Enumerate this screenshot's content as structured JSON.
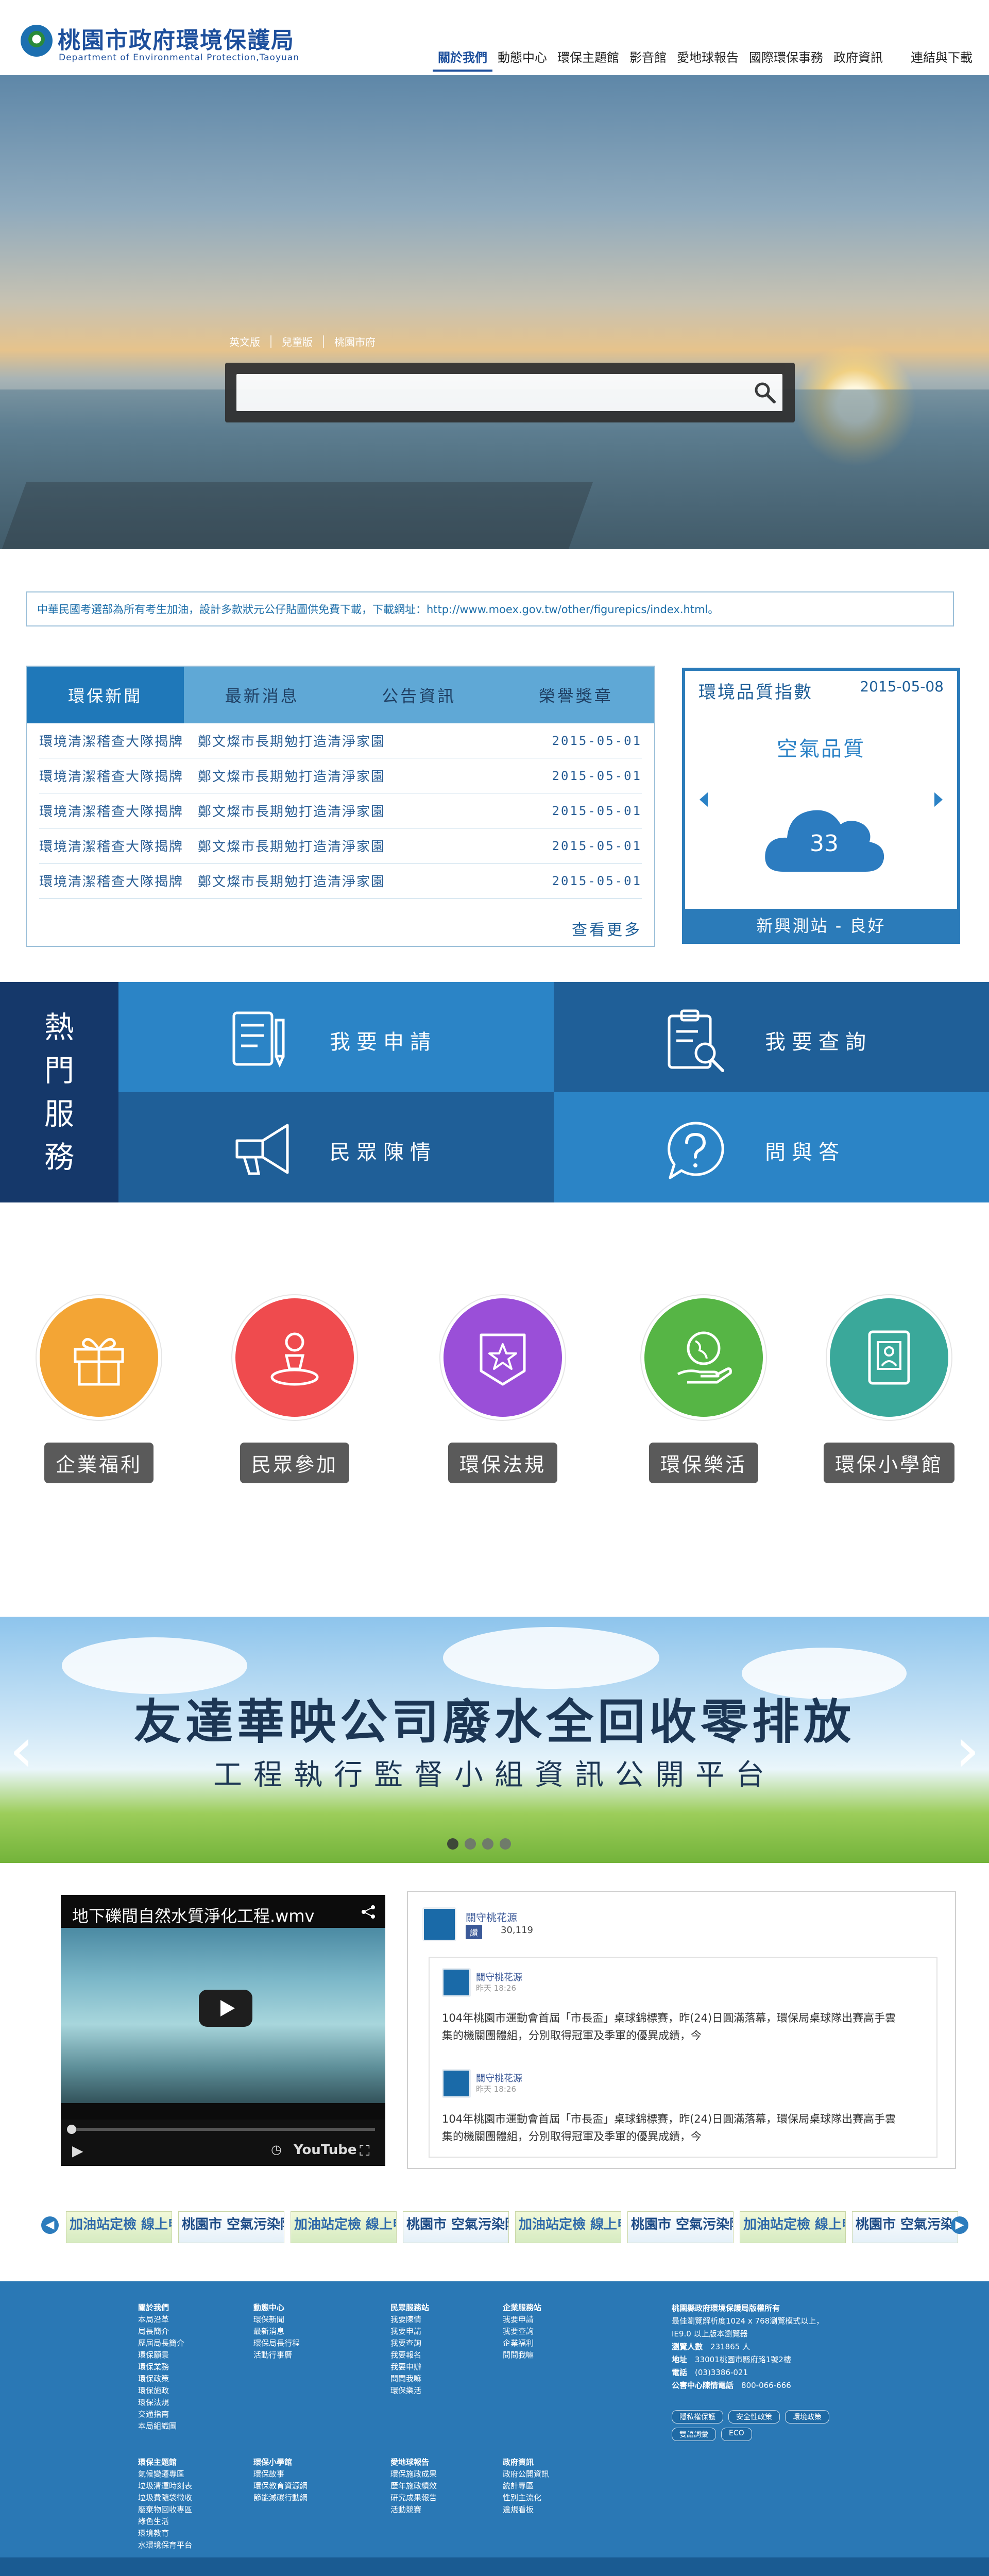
{
  "header": {
    "logo_title": "桃園市政府環境保護局",
    "logo_subtitle": "Department of Environmental Protection,Taoyuan",
    "nav": [
      "關於我們",
      "動態中心",
      "環保主題館",
      "影音館",
      "愛地球報告",
      "國際環保事務",
      "政府資訊",
      "連結與下載"
    ]
  },
  "hero": {
    "links": [
      "英文版",
      "兒童版",
      "桃園市府"
    ],
    "search_placeholder": ""
  },
  "notice": "中華民國考選部為所有考生加油，設計多款狀元公仔貼圖供免費下載，下載網址：http://www.moex.gov.tw/other/figurepics/index.html。",
  "news": {
    "tabs": [
      "環保新聞",
      "最新消息",
      "公告資訊",
      "榮譽獎章"
    ],
    "rows": [
      {
        "title": "環境清潔稽查大隊揭牌　鄭文燦市長期勉打造清淨家園",
        "date": "2015-05-01"
      },
      {
        "title": "環境清潔稽查大隊揭牌　鄭文燦市長期勉打造清淨家園",
        "date": "2015-05-01"
      },
      {
        "title": "環境清潔稽查大隊揭牌　鄭文燦市長期勉打造清淨家園",
        "date": "2015-05-01"
      },
      {
        "title": "環境清潔稽查大隊揭牌　鄭文燦市長期勉打造清淨家園",
        "date": "2015-05-01"
      },
      {
        "title": "環境清潔稽查大隊揭牌　鄭文燦市長期勉打造清淨家園",
        "date": "2015-05-01"
      }
    ],
    "more": "查看更多"
  },
  "air_quality": {
    "heading": "環境品質指數",
    "date": "2015-05-08",
    "title": "空氣品質",
    "value": "33",
    "station": "新興測站 - 良好",
    "cloud_color": "#2c7cc0"
  },
  "hot_services": {
    "label": [
      "熱",
      "門",
      "服",
      "務"
    ],
    "items": [
      {
        "label": "我要申請",
        "icon": "document-pen-icon"
      },
      {
        "label": "我要查詢",
        "icon": "clipboard-search-icon"
      },
      {
        "label": "民眾陳情",
        "icon": "megaphone-icon"
      },
      {
        "label": "問與答",
        "icon": "question-bubble-icon"
      }
    ],
    "colors": {
      "light": "#2b84c6",
      "dark": "#1f5f98",
      "label_bg": "#15386a"
    }
  },
  "circles": [
    {
      "label": "企業福利",
      "icon": "gift-icon",
      "color": "#f3a535"
    },
    {
      "label": "民眾參加",
      "icon": "location-person-icon",
      "color": "#ef4b4e"
    },
    {
      "label": "環保法規",
      "icon": "star-badge-icon",
      "color": "#9a4fd8"
    },
    {
      "label": "環保樂活",
      "icon": "earth-hand-icon",
      "color": "#56b545"
    },
    {
      "label": "環保小學館",
      "icon": "book-person-icon",
      "color": "#3aa89a"
    }
  ],
  "banner": {
    "title": "友達華映公司廢水全回收零排放",
    "subtitle": "工程執行監督小組資訊公開平台",
    "slides": 4,
    "active_slide": 1
  },
  "video": {
    "title": "地下礫間自然水質淨化工程.wmv",
    "brand": "YouTube"
  },
  "facebook": {
    "page_name": "關守桃花源",
    "like_label": "讚",
    "like_count": "30,119",
    "posts": [
      {
        "name": "關守桃花源",
        "time": "昨天 18:26",
        "text": "104年桃園市運動會首屆「市長盃」桌球錦標賽，昨(24)日圓滿落幕，環保局桌球隊出賽高手雲集的機關團體組，分別取得冠軍及季軍的優異成績，今"
      },
      {
        "name": "關守桃花源",
        "time": "昨天 18:26",
        "text": "104年桃園市運動會首屆「市長盃」桌球錦標賽，昨(24)日圓滿落幕，環保局桌球隊出賽高手雲集的機關團體組，分別取得冠軍及季軍的優異成績，今"
      }
    ]
  },
  "link_banners": [
    {
      "text": "加油站定檢 線上申報系統",
      "style": "a"
    },
    {
      "text": "桃園市 空氣污染防制基金",
      "style": "b"
    },
    {
      "text": "加油站定檢 線上申報系統",
      "style": "a"
    },
    {
      "text": "桃園市 空氣污染防制基金",
      "style": "b"
    },
    {
      "text": "加油站定檢 線上申報系統",
      "style": "a"
    },
    {
      "text": "桃園市 空氣污染防制基金",
      "style": "b"
    },
    {
      "text": "加油站定檢 線上申報系統",
      "style": "a"
    },
    {
      "text": "桃園市 空氣污染防制基金",
      "style": "b"
    }
  ],
  "footer": {
    "columns_top": [
      {
        "head": "關於我們",
        "items": [
          "本局沿革",
          "局長簡介",
          "歷屆局長簡介",
          "環保願景",
          "環保業務",
          "環保政策",
          "環保施政",
          "環保法規",
          "交通指南",
          "本局組織圖"
        ]
      },
      {
        "head": "動態中心",
        "items": [
          "環保新聞",
          "最新消息",
          "環保局長行程",
          "活動行事曆"
        ]
      },
      {
        "head": "民眾服務站",
        "items": [
          "我要陳情",
          "我要申請",
          "我要查詢",
          "我要報名",
          "我要申辦",
          "問問我嘛",
          "環保樂活"
        ]
      },
      {
        "head": "企業服務站",
        "items": [
          "我要申請",
          "我要查詢",
          "企業福利",
          "問問我嘛"
        ]
      }
    ],
    "columns_bottom": [
      {
        "head": "環保主題館",
        "items": [
          "氣候變遷專區",
          "垃圾清運時刻表",
          "垃圾費隨袋徵收",
          "廢棄物回收專區",
          "綠色生活",
          "環境教育",
          "水環境保育平台"
        ]
      },
      {
        "head": "環保小學館",
        "items": [
          "環保故事",
          "環保教育資源網",
          "節能減碳行動網"
        ]
      },
      {
        "head": "愛地球報告",
        "items": [
          "環保施政成果",
          "歷年施政績效",
          "研究成果報告",
          "活動競賽"
        ]
      },
      {
        "head": "政府資訊",
        "items": [
          "政府公開資訊",
          "統計專區",
          "性別主流化",
          "違規看板"
        ]
      }
    ],
    "info": {
      "org": "桃園縣政府環境保護局版權所有",
      "best_view": "最佳瀏覽解析度1024 x 768瀏覽模式以上，",
      "browser": "IE9.0 以上版本瀏覽器",
      "visitors_label": "瀏覽人數",
      "visitors": "231865 人",
      "address_label": "地址",
      "address": "33001桃園市縣府路1號2樓",
      "phone_label": "電話",
      "phone": "(03)3386-021",
      "hotline_label": "公害中心陳情電話",
      "hotline": "800-066-666"
    },
    "buttons": [
      "隱私權保護",
      "安全性政策",
      "環境政策",
      "雙語詞彙",
      "ECO"
    ]
  }
}
